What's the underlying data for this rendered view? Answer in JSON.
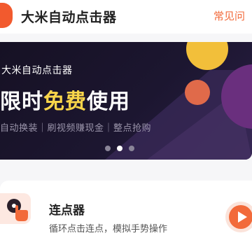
{
  "header": {
    "title": "大米自动点击器",
    "faq_link": "常见问"
  },
  "banner": {
    "small_title": "大米自动点击器",
    "headline_part1": "限时",
    "headline_part2": "免费",
    "headline_part3": "使用",
    "subtitle": "自动换装｜刷视频赚现金｜整点抢购",
    "carousel_pages": 3,
    "carousel_active": 2
  },
  "feature_card": {
    "title": "连点器",
    "description": "循环点击连点，模拟手势操作",
    "icon": "tap-hand-icon",
    "action_icon": "play-icon"
  },
  "colors": {
    "accent": "#f26a3a",
    "headline_yellow": "#f9d54a",
    "banner_bg": "#1c1630"
  }
}
